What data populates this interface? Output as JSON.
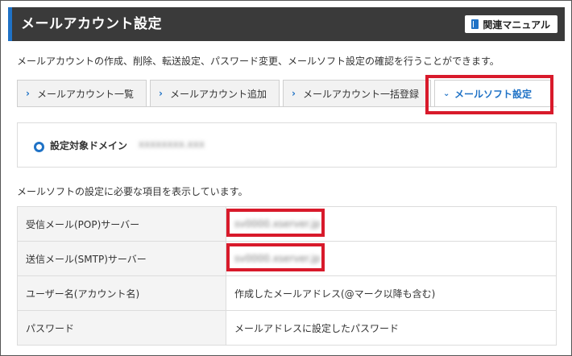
{
  "header": {
    "title": "メールアカウント設定",
    "manual_button": "関連マニュアル"
  },
  "description": "メールアカウントの作成、削除、転送設定、パスワード変更、メールソフト設定の確認を行うことができます。",
  "tabs": [
    {
      "label": "メールアカウント一覧",
      "active": false
    },
    {
      "label": "メールアカウント追加",
      "active": false
    },
    {
      "label": "メールアカウント一括登録",
      "active": false
    },
    {
      "label": "メールソフト設定",
      "active": true
    }
  ],
  "domain": {
    "label": "設定対象ドメイン",
    "value": "xxxxxxxx.xxx"
  },
  "info": "メールソフトの設定に必要な項目を表示しています。",
  "settings": [
    {
      "key": "受信メール(POP)サーバー",
      "value": "sv0000.xserver.jp"
    },
    {
      "key": "送信メール(SMTP)サーバー",
      "value": "sv0000.xserver.jp"
    },
    {
      "key": "ユーザー名(アカウント名)",
      "value": "作成したメールアドレス(@マーク以降も含む)"
    },
    {
      "key": "パスワード",
      "value": "メールアドレスに設定したパスワード"
    }
  ],
  "colors": {
    "header_bg": "#3a3a3a",
    "accent": "#1f72c6",
    "highlight": "#d81a2b"
  }
}
